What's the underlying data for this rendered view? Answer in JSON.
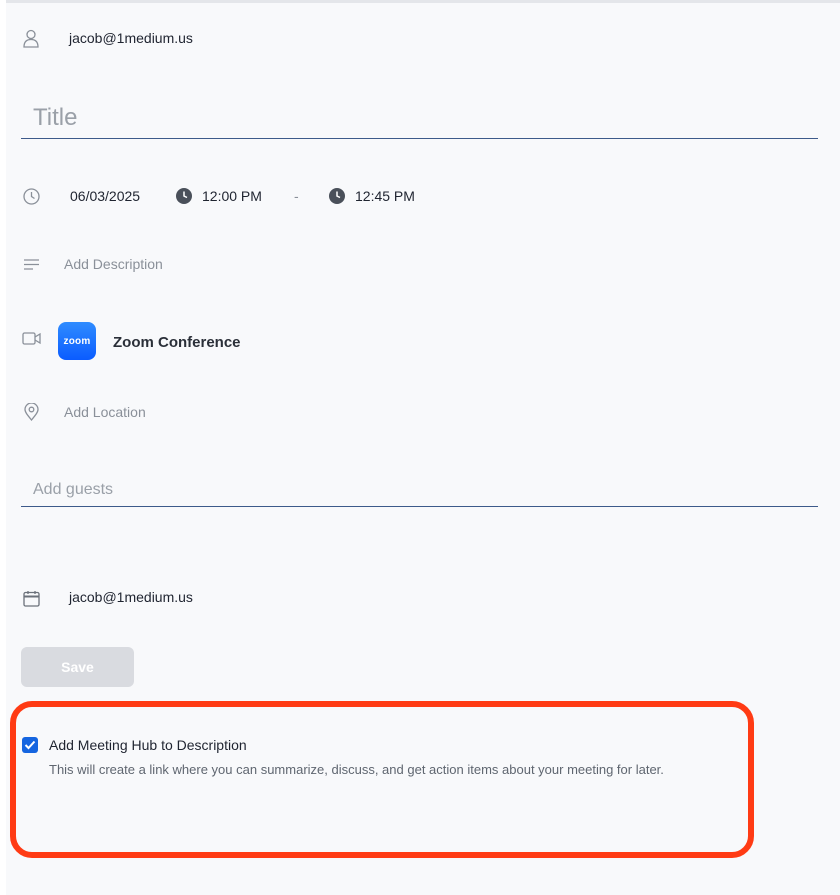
{
  "organizer": {
    "email": "jacob@1medium.us"
  },
  "title_field": {
    "placeholder": "Title",
    "value": ""
  },
  "schedule": {
    "date": "06/03/2025",
    "start_time": "12:00 PM",
    "separator": "-",
    "end_time": "12:45 PM"
  },
  "description": {
    "placeholder": "Add Description"
  },
  "conference": {
    "logo_text": "zoom",
    "label": "Zoom Conference",
    "brand_color": "#0b5cff"
  },
  "location": {
    "placeholder": "Add Location"
  },
  "guests_field": {
    "placeholder": "Add guests",
    "value": ""
  },
  "calendar": {
    "email": "jacob@1medium.us"
  },
  "save_button": {
    "label": "Save"
  },
  "meeting_hub": {
    "checked": true,
    "label": "Add Meeting Hub to Description",
    "description": "This will create a link where you can summarize, discuss, and get action items about your meeting for later.",
    "highlight_color": "#ff3b14"
  }
}
